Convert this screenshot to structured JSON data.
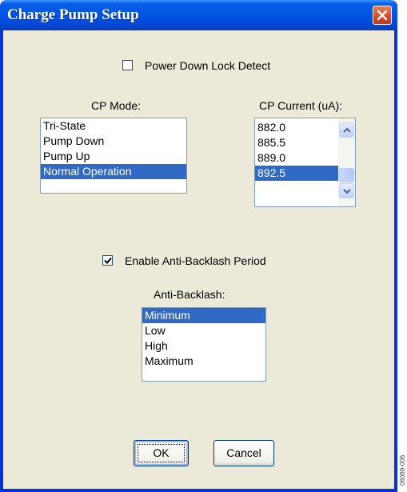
{
  "window": {
    "title": "Charge Pump Setup"
  },
  "power_down_lock_detect": {
    "label": "Power Down Lock Detect",
    "checked": false
  },
  "cp_mode": {
    "label": "CP Mode:",
    "items": [
      "Tri-State",
      "Pump Down",
      "Pump Up",
      "Normal Operation"
    ],
    "selected": "Normal Operation"
  },
  "cp_current": {
    "label": "CP Current (uA):",
    "items": [
      "882.0",
      "885.5",
      "889.0",
      "892.5"
    ],
    "selected": "892.5"
  },
  "enable_anti_backlash": {
    "label": "Enable Anti-Backlash Period",
    "checked": true
  },
  "anti_backlash": {
    "label": "Anti-Backlash:",
    "items": [
      "Minimum",
      "Low",
      "High",
      "Maximum"
    ],
    "selected": "Minimum"
  },
  "buttons": {
    "ok": "OK",
    "cancel": "Cancel"
  },
  "side_note": "06089-006",
  "colors": {
    "selection": "#316ac5",
    "title_bar": "#0055e5",
    "dialog_face": "#ece9d8"
  }
}
